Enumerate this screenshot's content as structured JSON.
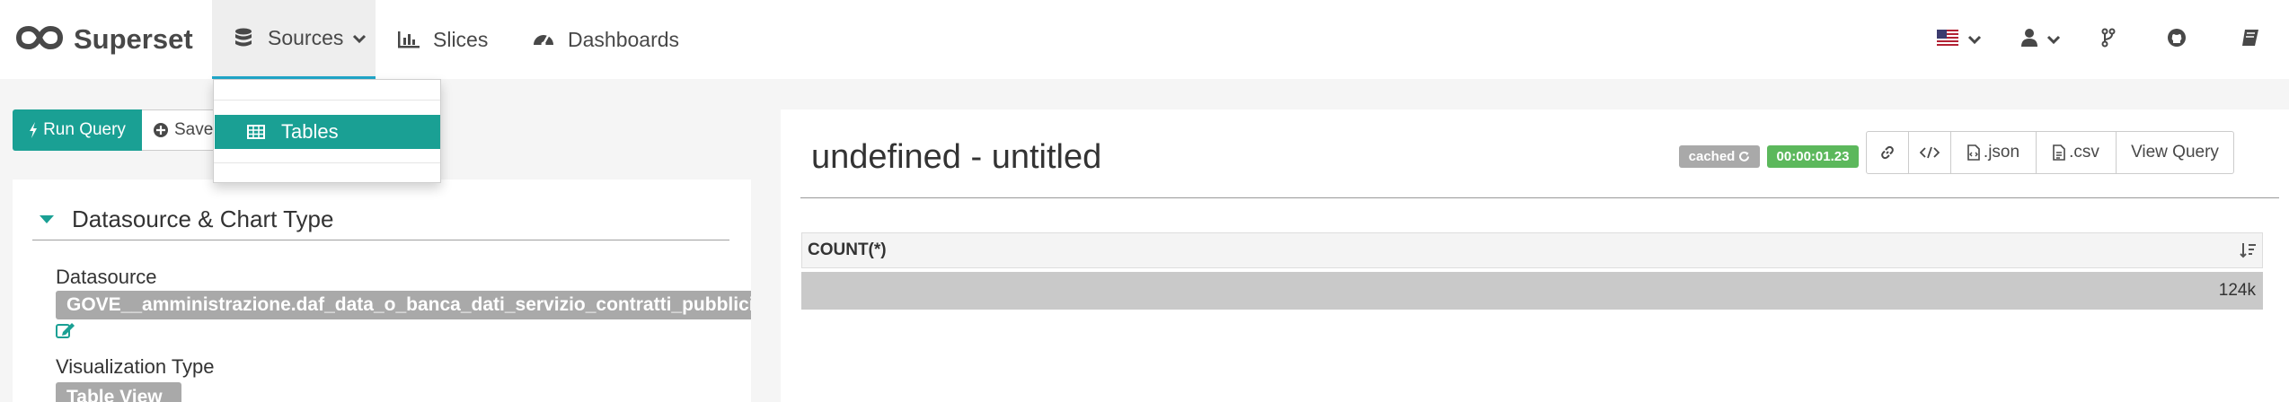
{
  "brand": {
    "name": "Superset",
    "logo_icon": "infinity-icon"
  },
  "nav": {
    "sources": {
      "label": "Sources",
      "icon": "database-icon"
    },
    "slices": {
      "label": "Slices",
      "icon": "bar-chart-icon"
    },
    "dashboards": {
      "label": "Dashboards",
      "icon": "dashboard-gauge-icon"
    }
  },
  "dropdown": {
    "items": [
      {
        "label": "Tables",
        "icon": "table-icon"
      }
    ]
  },
  "nav_right": {
    "icons": [
      "us-flag-icon",
      "user-icon",
      "code-fork-icon",
      "github-icon",
      "book-icon"
    ]
  },
  "query_controls": {
    "run_label": "Run Query",
    "save_label": "Save"
  },
  "left_panel": {
    "section_title": "Datasource & Chart Type",
    "datasource_label": "Datasource",
    "datasource_value": "GOVE__amministrazione.daf_data_o_banca_dati_servizio_contratti_pubblici",
    "viz_type_label": "Visualization Type",
    "viz_type_value": "Table View"
  },
  "slice": {
    "title": "undefined - untitled",
    "cached_label": "cached",
    "duration": "00:00:01.23",
    "buttons": {
      "json": ".json",
      "csv": ".csv",
      "view_query": "View Query"
    }
  },
  "table": {
    "columns": [
      "COUNT(*)"
    ],
    "rows": [
      [
        "124k"
      ]
    ]
  },
  "colors": {
    "accent": "#1aa094",
    "nav_active_border": "#20a7c9",
    "success": "#5cb85c",
    "label_gray": "#a9a9a9"
  }
}
